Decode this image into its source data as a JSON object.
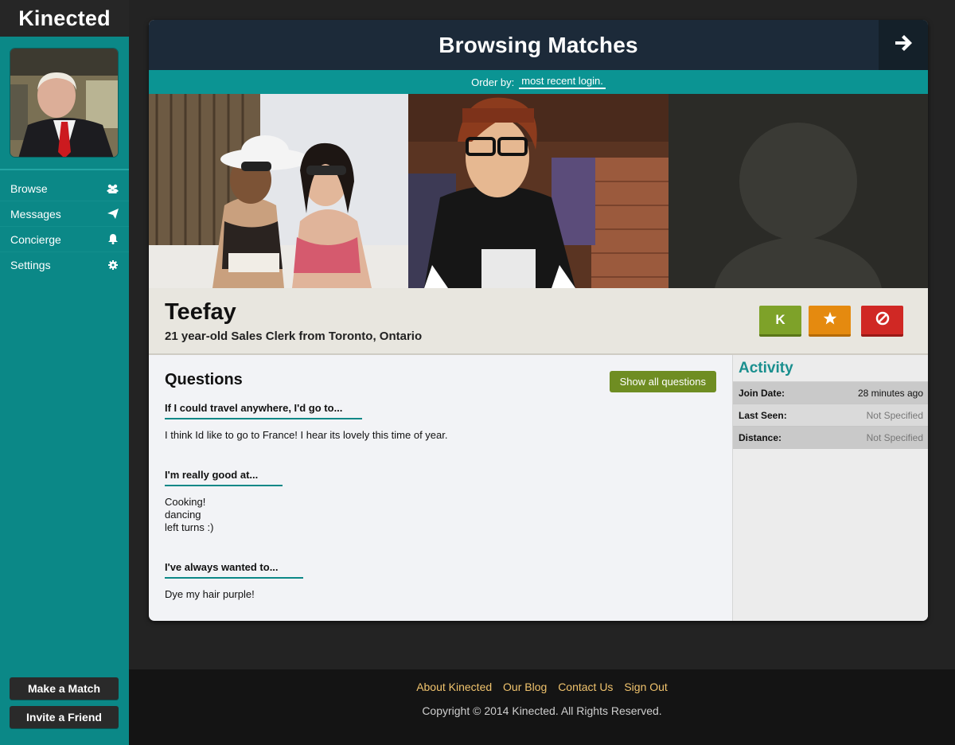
{
  "app": {
    "brand": "Kinected"
  },
  "sidebar": {
    "items": [
      {
        "label": "Browse",
        "icon": "users-icon"
      },
      {
        "label": "Messages",
        "icon": "paper-plane-icon"
      },
      {
        "label": "Concierge",
        "icon": "bell-icon"
      },
      {
        "label": "Settings",
        "icon": "gear-icon"
      }
    ],
    "make_match": "Make a Match",
    "invite_friend": "Invite a Friend"
  },
  "header": {
    "title": "Browsing Matches",
    "next_icon": "arrow-right-icon"
  },
  "order": {
    "prefix": "Order by:",
    "value": "most recent login."
  },
  "profile": {
    "name": "Teefay",
    "subtitle": "21 year-old Sales Clerk from Toronto, Ontario",
    "actions": {
      "kinect_label": "K",
      "favorite_icon": "star-icon",
      "block_icon": "block-icon"
    }
  },
  "questions": {
    "heading": "Questions",
    "show_all": "Show all questions",
    "items": [
      {
        "question": "If I could travel anywhere, I'd go to...",
        "answer": [
          "I think Id like to go to France! I hear its lovely this time of year."
        ]
      },
      {
        "question": "I'm really good at...",
        "answer": [
          "Cooking!",
          "dancing",
          "left turns :)"
        ]
      },
      {
        "question": "I've always wanted to...",
        "answer": [
          "Dye my hair purple!"
        ]
      }
    ]
  },
  "activity": {
    "title": "Activity",
    "rows": [
      {
        "label": "Join Date:",
        "value": "28 minutes ago"
      },
      {
        "label": "Last Seen:",
        "value": "Not Specified"
      },
      {
        "label": "Distance:",
        "value": "Not Specified"
      }
    ]
  },
  "footer": {
    "links": [
      "About Kinected",
      "Our Blog",
      "Contact Us",
      "Sign Out"
    ],
    "copyright": "Copyright © 2014 Kinected. All Rights Reserved."
  },
  "colors": {
    "sidebar": "#0b8887",
    "header": "#1c2a39",
    "order_bar": "#0b9493",
    "kinect_button": "#7ea229",
    "favorite_button": "#e58a0f",
    "block_button": "#d02824",
    "footer_link": "#f0c36d"
  }
}
